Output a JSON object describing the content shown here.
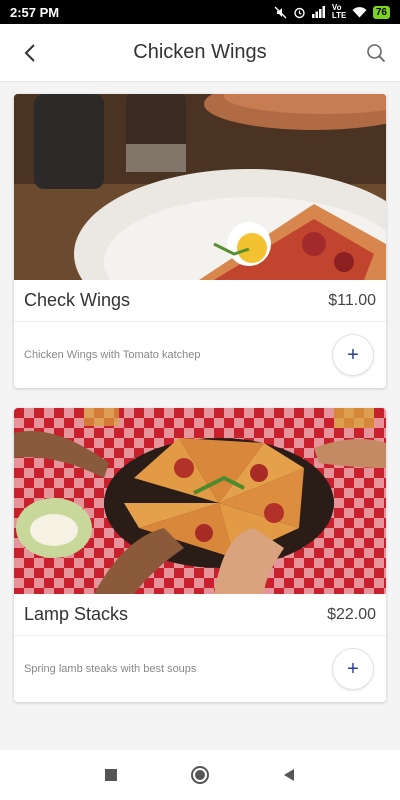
{
  "status_bar": {
    "time": "2:57 PM",
    "network": "Vo LTE",
    "battery": "76",
    "icons": [
      "mute-icon",
      "alarm-icon",
      "signal-icon",
      "volte-icon",
      "wifi-icon",
      "battery-icon"
    ]
  },
  "header": {
    "title": "Chicken Wings",
    "back_icon": "back-arrow-icon",
    "search_icon": "search-icon"
  },
  "items": [
    {
      "name": "Check Wings",
      "price": "$11.00",
      "description": "Chicken Wings with Tomato katchep",
      "add_label": "+",
      "image": "pizza-plate-photo"
    },
    {
      "name": "Lamp Stacks",
      "price": "$22.00",
      "description": "Spring lamb steaks with best soups",
      "add_label": "+",
      "image": "pizza-sharing-photo"
    }
  ],
  "nav_bar": {
    "icons": [
      "recents-square-icon",
      "home-circle-icon",
      "back-triangle-icon"
    ]
  },
  "colors": {
    "accent": "#2a3f8f",
    "status_bar": "#000000",
    "battery": "#7ed321"
  }
}
